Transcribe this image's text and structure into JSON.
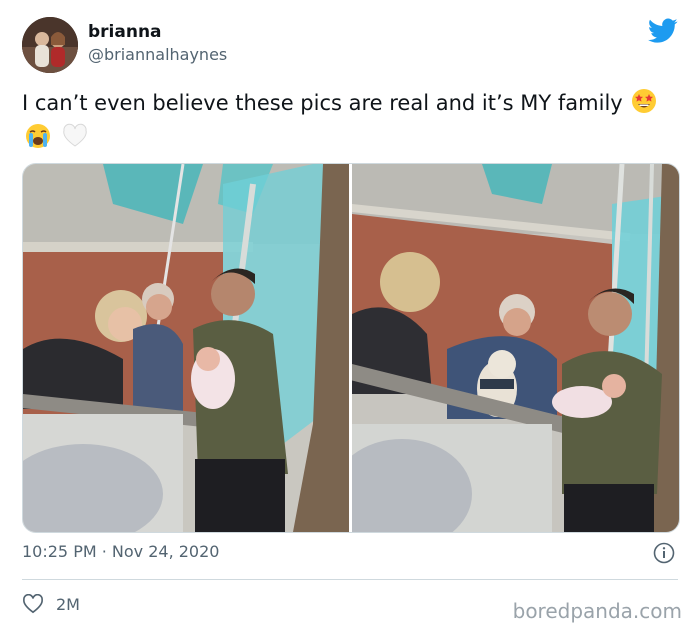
{
  "author": {
    "display_name": "brianna",
    "handle": "@briannalhaynes",
    "avatar_icon": "profile-avatar"
  },
  "brand_icon": "twitter-bird-icon",
  "tweet": {
    "text": "I can’t even believe these pics are real and it’s MY family",
    "emojis": [
      "star-struck-emoji",
      "loudly-crying-emoji",
      "white-heart-emoji"
    ]
  },
  "media": [
    {
      "subject": "photo-grandparents-window-left"
    },
    {
      "subject": "photo-grandparents-window-right"
    }
  ],
  "meta": {
    "timestamp": "10:25 PM · Nov 24, 2020",
    "info_icon": "info-icon"
  },
  "actions": {
    "like_count": "2M",
    "like_icon": "heart-outline-icon"
  },
  "watermark": "boredpanda.com",
  "colors": {
    "twitter_blue": "#1d9bf0",
    "text_primary": "#0f1419",
    "text_secondary": "#536471",
    "border": "#cfd9de"
  }
}
